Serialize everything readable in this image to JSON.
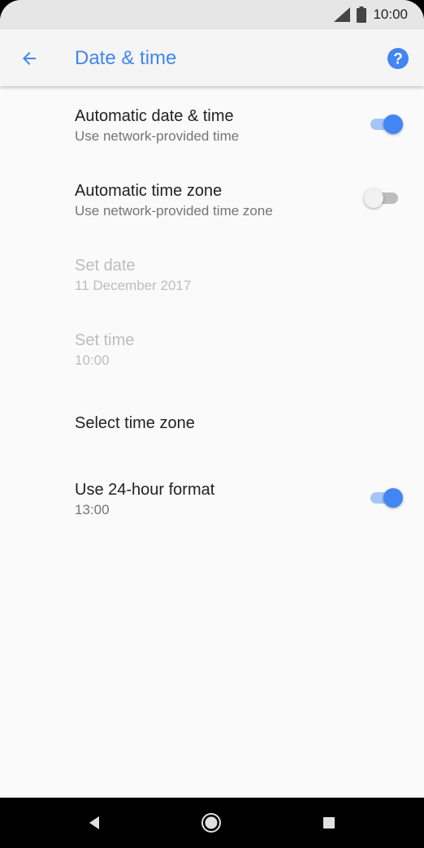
{
  "status_bar": {
    "time": "10:00",
    "icons": [
      "signal-icon",
      "battery-icon"
    ]
  },
  "app_bar": {
    "title": "Date & time",
    "back_icon": "arrow-back-icon",
    "help_icon": "help-icon"
  },
  "settings": [
    {
      "title": "Automatic date & time",
      "summary": "Use network-provided time",
      "toggle": true,
      "enabled": true
    },
    {
      "title": "Automatic time zone",
      "summary": "Use network-provided time zone",
      "toggle": false,
      "enabled": true
    },
    {
      "title": "Set date",
      "summary": "11 December 2017",
      "enabled": false
    },
    {
      "title": "Set time",
      "summary": "10:00",
      "enabled": false
    },
    {
      "title": "Select time zone",
      "summary": "",
      "enabled": true
    },
    {
      "title": "Use 24-hour format",
      "summary": "13:00",
      "toggle": true,
      "enabled": true
    }
  ],
  "nav_bar": {
    "buttons": [
      "back-triangle-icon",
      "home-circle-icon",
      "recents-square-icon"
    ]
  },
  "colors": {
    "accent": "#4285f4",
    "status_bar": "#e6e6e6",
    "background": "#fafafa",
    "nav_bar": "#000000"
  }
}
